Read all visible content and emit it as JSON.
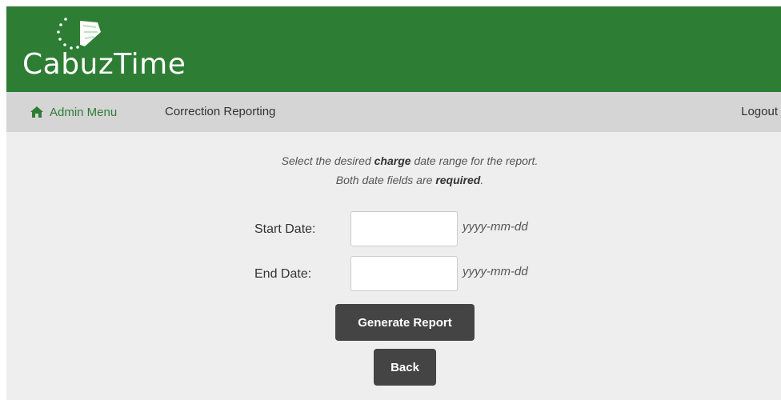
{
  "header": {
    "brand": "CabuzTime",
    "logo_icon": "cabuztime-logo-icon",
    "background_color": "#2e7d34"
  },
  "nav": {
    "home_label": "Admin Menu",
    "home_icon": "home-icon",
    "page_title": "Correction Reporting",
    "logout_label": "Logout"
  },
  "instructions": {
    "line1_prefix": "Select the desired ",
    "line1_bold": "charge",
    "line1_suffix": " date range for the report.",
    "line2_prefix": "Both date fields are ",
    "line2_bold": "required",
    "line2_suffix": "."
  },
  "form": {
    "start_label": "Start Date:",
    "start_value": "",
    "start_hint": "yyyy-mm-dd",
    "end_label": "End Date:",
    "end_value": "",
    "end_hint": "yyyy-mm-dd"
  },
  "buttons": {
    "generate_label": "Generate Report",
    "back_label": "Back"
  }
}
